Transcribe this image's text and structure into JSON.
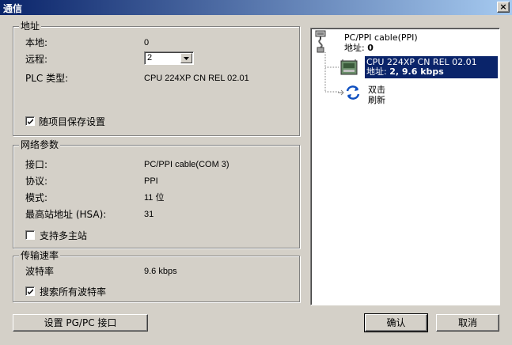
{
  "window": {
    "title": "通信",
    "close_glyph": "×"
  },
  "address": {
    "legend": "地址",
    "local_label": "本地:",
    "local_value": "0",
    "remote_label": "远程:",
    "remote_value": "2",
    "plc_type_label": "PLC 类型:",
    "plc_type_value": "CPU 224XP CN REL 02.01",
    "save_with_project_label": "随项目保存设置",
    "save_with_project_checked": true
  },
  "network": {
    "legend": "网络参数",
    "interface_label": "接口:",
    "interface_value": "PC/PPI cable(COM 3)",
    "protocol_label": "协议:",
    "protocol_value": "PPI",
    "mode_label": "模式:",
    "mode_value": "11 位",
    "hsa_label": "最高站地址 (HSA):",
    "hsa_value": "31",
    "multimaster_label": "支持多主站",
    "multimaster_checked": false
  },
  "baud": {
    "legend": "传输速率",
    "rate_label": "波特率",
    "rate_value": "9.6 kbps",
    "search_all_label": "搜索所有波特率",
    "search_all_checked": true
  },
  "tree": {
    "cable_name": "PC/PPI cable(PPI)",
    "cable_addr_label": "地址:",
    "cable_addr_value": "0",
    "plc_name": "CPU 224XP CN REL 02.01",
    "plc_addr_label": "地址:",
    "plc_addr_value": "2, 9.6 kbps",
    "refresh_line1": "双击",
    "refresh_line2": "刷新"
  },
  "buttons": {
    "setpgpc": "设置 PG/PC 接口",
    "ok": "确认",
    "cancel": "取消"
  },
  "colors": {
    "titlebar_start": "#0a246a",
    "titlebar_end": "#a6caf0",
    "selection": "#0a246a",
    "face": "#d4d0c8"
  }
}
